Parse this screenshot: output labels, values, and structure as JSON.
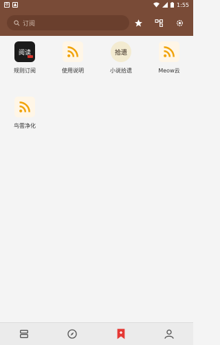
{
  "status_bar": {
    "time": "1:55",
    "left_icons": [
      "settings-icon",
      "notification-icon"
    ],
    "right_icons": [
      "wifi-icon",
      "signal-icon",
      "battery-icon"
    ]
  },
  "app_bar": {
    "search_placeholder": "订阅",
    "actions": [
      "star-icon",
      "group-icon",
      "settings-icon"
    ]
  },
  "subscriptions": [
    {
      "label": "规则订阅",
      "icon": "rule-book-icon",
      "tile_text": "阅读"
    },
    {
      "label": "使用说明",
      "icon": "rss-icon"
    },
    {
      "label": "小说拾遗",
      "icon": "novel-logo-icon",
      "tile_text": "拾遗"
    },
    {
      "label": "Meow云",
      "icon": "rss-icon"
    },
    {
      "label": "鸟雲净化",
      "icon": "rss-icon"
    }
  ],
  "bottom_nav": [
    {
      "name": "bookshelf",
      "icon": "bookshelf-icon",
      "active": false
    },
    {
      "name": "discover",
      "icon": "compass-icon",
      "active": false
    },
    {
      "name": "subscription",
      "icon": "bookmark-icon",
      "active": true
    },
    {
      "name": "profile",
      "icon": "person-icon",
      "active": false
    }
  ],
  "colors": {
    "primary": "#794b37",
    "accent": "#e53935",
    "rss": "#f0a30a"
  }
}
